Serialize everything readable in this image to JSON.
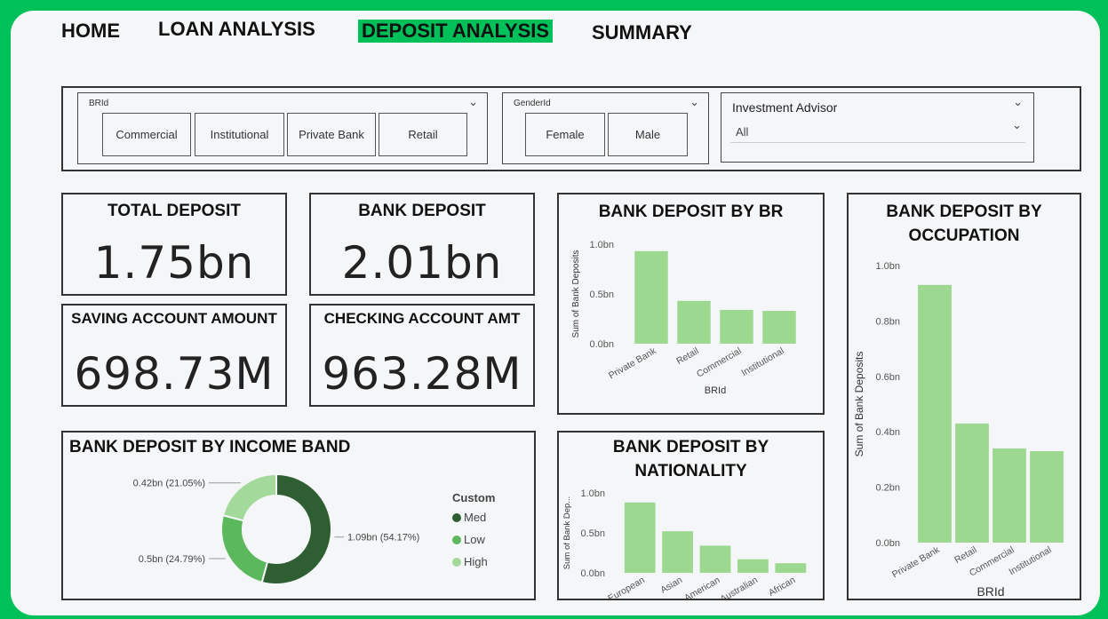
{
  "nav": {
    "home": "HOME",
    "loan": "LOAN ANALYSIS",
    "deposit": "DEPOSIT ANALYSIS",
    "summary": "SUMMARY"
  },
  "filters": {
    "brid": {
      "title": "BRId",
      "options": [
        "Commercial",
        "Institutional",
        "Private Bank",
        "Retail"
      ]
    },
    "gender": {
      "title": "GenderId",
      "options": [
        "Female",
        "Male"
      ]
    },
    "advisor": {
      "title": "Investment Advisor",
      "value": "All"
    }
  },
  "kpis": {
    "total_deposit": {
      "title": "TOTAL DEPOSIT",
      "value": "1.75bn"
    },
    "bank_deposit": {
      "title": "BANK DEPOSIT",
      "value": "2.01bn"
    },
    "saving_amount": {
      "title": "SAVING ACCOUNT AMOUNT",
      "value": "698.73M"
    },
    "checking_amount": {
      "title": "CHECKING ACCOUNT AMT",
      "value": "963.28M"
    }
  },
  "colors": {
    "accent": "#00c05a",
    "bar": "#9dd890",
    "med": "#2e5e31",
    "low": "#5cb85c",
    "high": "#a3d99b"
  },
  "chart_data": [
    {
      "type": "bar",
      "title": "BANK DEPOSIT BY BR",
      "xlabel": "BRId",
      "ylabel": "Sum of Bank Deposits",
      "categories": [
        "Private Bank",
        "Retail",
        "Commercial",
        "Institutional"
      ],
      "values": [
        0.93,
        0.43,
        0.34,
        0.33
      ],
      "ylim": [
        0,
        1.0
      ],
      "yticks": [
        "0.0bn",
        "0.5bn",
        "1.0bn"
      ],
      "grid": false
    },
    {
      "type": "bar",
      "title": "BANK DEPOSIT BY OCCUPATION",
      "xlabel": "BRId",
      "ylabel": "Sum of Bank Deposits",
      "categories": [
        "Private Bank",
        "Retail",
        "Commercial",
        "Institutional"
      ],
      "values": [
        0.93,
        0.43,
        0.34,
        0.33
      ],
      "ylim": [
        0,
        1.0
      ],
      "yticks": [
        "0.0bn",
        "0.2bn",
        "0.4bn",
        "0.6bn",
        "0.8bn",
        "1.0bn"
      ],
      "grid": false
    },
    {
      "type": "bar",
      "title": "BANK DEPOSIT BY NATIONALITY",
      "xlabel": "",
      "ylabel": "Sum of Bank Dep...",
      "categories": [
        "European",
        "Asian",
        "American",
        "Australian",
        "African"
      ],
      "values": [
        0.88,
        0.52,
        0.34,
        0.17,
        0.12
      ],
      "ylim": [
        0,
        1.0
      ],
      "yticks": [
        "0.0bn",
        "0.5bn",
        "1.0bn"
      ],
      "grid": false
    },
    {
      "type": "pie",
      "title": "BANK DEPOSIT BY INCOME BAND",
      "legend_title": "Custom",
      "legend_position": "right",
      "slices": [
        {
          "name": "Med",
          "value": 1.09,
          "label": "1.09bn (54.17%)"
        },
        {
          "name": "Low",
          "value": 0.5,
          "label": "0.5bn (24.79%)"
        },
        {
          "name": "High",
          "value": 0.42,
          "label": "0.42bn (21.05%)"
        }
      ]
    }
  ]
}
